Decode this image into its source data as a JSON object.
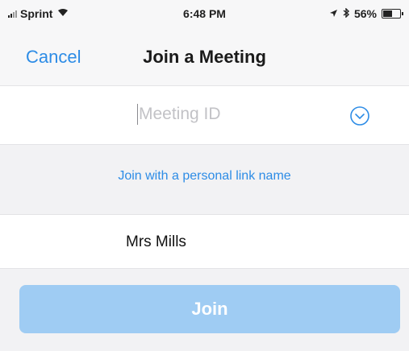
{
  "status_bar": {
    "carrier": "Sprint",
    "time": "6:48 PM",
    "battery_percent": "56%",
    "battery_level": 0.56,
    "icons": [
      "signal-bars-icon",
      "wifi-icon",
      "location-arrow-icon",
      "bluetooth-icon",
      "battery-icon"
    ]
  },
  "nav": {
    "cancel_label": "Cancel",
    "title": "Join a Meeting"
  },
  "meeting_id": {
    "placeholder": "Meeting ID",
    "value": "",
    "dropdown_icon": "chevron-down-circle-icon"
  },
  "personal_link": {
    "label": "Join with a personal link name"
  },
  "name_field": {
    "value": "Mrs Mills"
  },
  "join": {
    "label": "Join",
    "enabled": false
  },
  "colors": {
    "accent": "#2d8ce6",
    "join_button_disabled": "#9fccf3",
    "background": "#f2f2f4"
  }
}
